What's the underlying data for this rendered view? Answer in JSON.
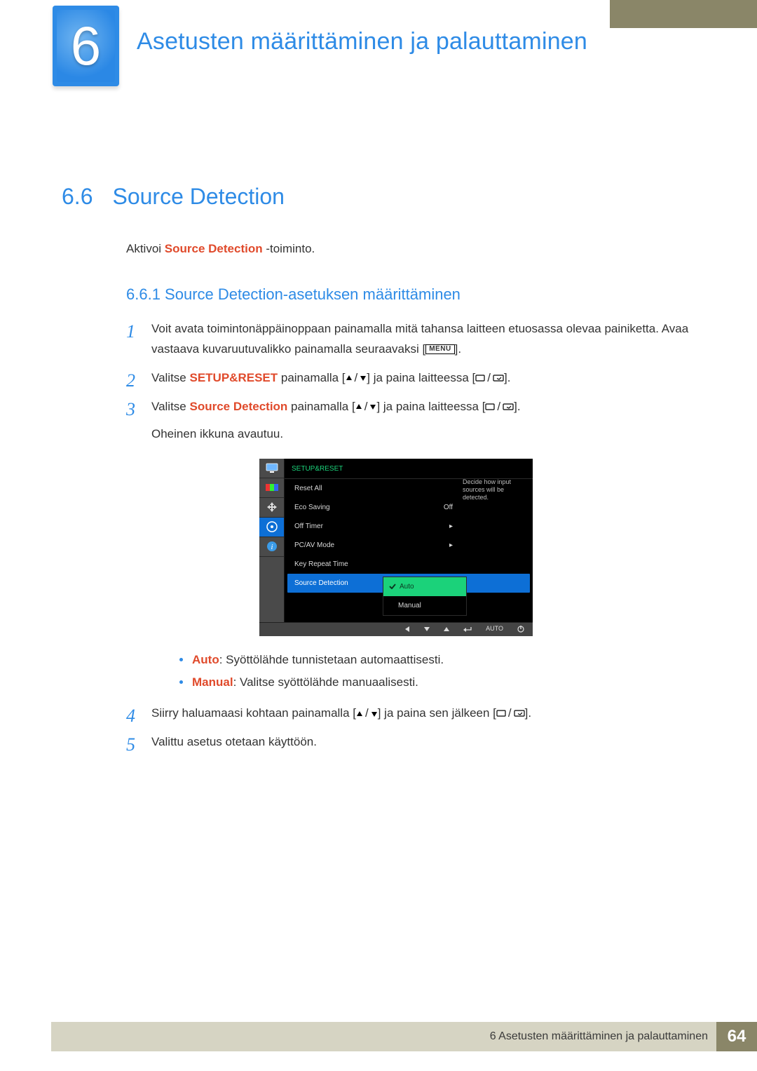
{
  "chapter": {
    "number": "6",
    "title": "Asetusten määrittäminen ja palauttaminen"
  },
  "section": {
    "number": "6.6",
    "title": "Source Detection"
  },
  "intro": {
    "pre": "Aktivoi ",
    "bold": "Source Detection",
    "post": " -toiminto."
  },
  "subsection": {
    "label": "6.6.1   Source Detection-asetuksen määrittäminen"
  },
  "steps": {
    "s1": {
      "n": "1",
      "a": "Voit avata toimintonäppäinoppaan painamalla mitä tahansa laitteen etuosassa olevaa painiketta. Avaa vastaava kuvaruutuvalikko painamalla seuraavaksi [",
      "b": "]."
    },
    "s2": {
      "n": "2",
      "a": "Valitse ",
      "bold": "SETUP&RESET",
      "b": " painamalla [",
      "c": "] ja paina laitteessa [",
      "d": "]."
    },
    "s3": {
      "n": "3",
      "a": "Valitse ",
      "bold": "Source Detection",
      "b": " painamalla [",
      "c": "] ja paina laitteessa [",
      "d": "].",
      "extra": "Oheinen ikkuna avautuu."
    },
    "s4": {
      "n": "4",
      "a": "Siirry haluamaasi kohtaan painamalla [",
      "b": "] ja paina sen jälkeen [",
      "c": "]."
    },
    "s5": {
      "n": "5",
      "a": "Valittu asetus otetaan käyttöön."
    }
  },
  "bullets": {
    "auto_label": "Auto",
    "auto_text": ": Syöttölähde tunnistetaan automaattisesti.",
    "manual_label": "Manual",
    "manual_text": ": Valitse syöttölähde manuaalisesti."
  },
  "osd": {
    "header": "SETUP&RESET",
    "rows": {
      "reset": "Reset All",
      "eco": "Eco Saving",
      "eco_val": "Off",
      "off_timer": "Off Timer",
      "pcav": "PC/AV Mode",
      "keyrepeat": "Key Repeat Time",
      "srcdet": "Source Detection"
    },
    "dropdown": {
      "auto": "Auto",
      "manual": "Manual"
    },
    "help": {
      "l1": "Decide how input",
      "l2": "sources will be",
      "l3": "detected."
    },
    "nav_auto": "AUTO"
  },
  "menu_label": "MENU",
  "footer": {
    "text": "6 Asetusten määrittäminen ja palauttaminen",
    "page": "64"
  }
}
